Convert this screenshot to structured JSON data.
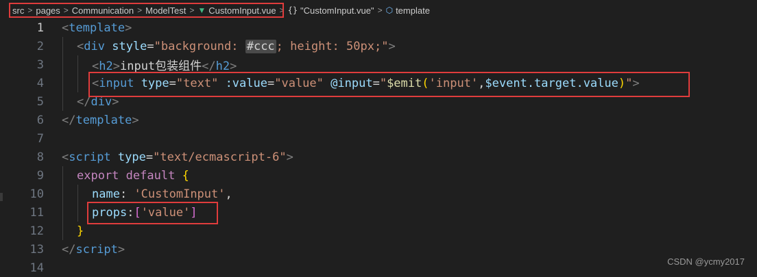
{
  "breadcrumb": {
    "items": [
      "src",
      "pages",
      "Communication",
      "ModelTest",
      "CustomInput.vue",
      "\"CustomInput.vue\"",
      "template"
    ],
    "separator": ">"
  },
  "editor": {
    "line_numbers": [
      "1",
      "2",
      "3",
      "4",
      "5",
      "6",
      "7",
      "8",
      "9",
      "10",
      "11",
      "12",
      "13",
      "14"
    ],
    "code": {
      "l1_open": "<",
      "l1_tag": "template",
      "l1_close": ">",
      "l2_open": "<",
      "l2_tag": "div",
      "l2_attr": "style",
      "l2_eq": "=",
      "l2_str1": "\"background: ",
      "l2_ccc": "#ccc",
      "l2_str2": "; height: 50px;\"",
      "l2_close": ">",
      "l3_open": "<",
      "l3_tag": "h2",
      "l3_close": ">",
      "l3_text": "input包装组件",
      "l3_end_open": "</",
      "l3_end_tag": "h2",
      "l3_end_close": ">",
      "l4_open": "<",
      "l4_tag": "input",
      "l4_attr1": "type",
      "l4_eq1": "=",
      "l4_str1": "\"text\"",
      "l4_attr2": ":value",
      "l4_eq2": "=",
      "l4_str2": "\"value\"",
      "l4_attr3": "@input",
      "l4_eq3": "=",
      "l4_q1": "\"",
      "l4_emit": "$emit",
      "l4_p1": "(",
      "l4_arg1": "'input'",
      "l4_comma": ",",
      "l4_event": "$event.target.value",
      "l4_p2": ")",
      "l4_q2": "\"",
      "l4_close": ">",
      "l5_open": "</",
      "l5_tag": "div",
      "l5_close": ">",
      "l6_open": "</",
      "l6_tag": "template",
      "l6_close": ">",
      "l8_open": "<",
      "l8_tag": "script",
      "l8_attr": "type",
      "l8_eq": "=",
      "l8_str": "\"text/ecmascript-6\"",
      "l8_close": ">",
      "l9_kw1": "export",
      "l9_kw2": "default",
      "l9_brace": "{",
      "l10_key": "name",
      "l10_colon": ": ",
      "l10_str": "'CustomInput'",
      "l10_comma": ",",
      "l11_key": "props",
      "l11_colon": ":",
      "l11_b1": "[",
      "l11_str": "'value'",
      "l11_b2": "]",
      "l12_brace": "}",
      "l13_open": "</",
      "l13_tag": "script",
      "l13_close": ">"
    }
  },
  "watermark": "CSDN @ycmy2017",
  "colors": {
    "background": "#1f1f1f",
    "highlight_box": "#e03c3c",
    "tag": "#569cd6",
    "attribute": "#9cdcfe",
    "string": "#ce9178",
    "keyword": "#c586c0",
    "function": "#dcdcaa",
    "brace": "#ffd700",
    "bracket": "#da70d6",
    "vue_green": "#41b883"
  },
  "icons": [
    "vue-file-icon",
    "braces-icon",
    "cube-icon"
  ]
}
